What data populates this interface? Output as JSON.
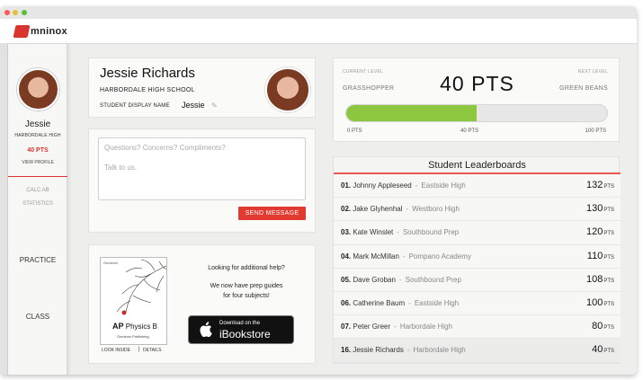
{
  "app": {
    "logo_text": "mninox",
    "brand_color": "#d9352e"
  },
  "sidebar": {
    "name": "Jessie",
    "school": "HARBORDALE HIGH",
    "points": "40 PTS",
    "view_profile": "VIEW PROFILE",
    "subject": "CALC AB",
    "statistics": "STATISTICS",
    "practice": "PRACTICE",
    "class": "CLASS"
  },
  "profile": {
    "name": "Jessie Richards",
    "school": "HARBORDALE HIGH SCHOOL",
    "display_name_label": "STUDENT DISPLAY NAME",
    "display_name": "Jessie"
  },
  "message": {
    "placeholder_line1": "Questions? Concerns? Compliments?",
    "placeholder_line2": "Talk to us.",
    "send_label": "SEND MESSAGE"
  },
  "promo": {
    "book_brand": "Omninox",
    "book_title_prefix": "AP",
    "book_title": "Physics B",
    "book_publisher": "Omninox Publishing",
    "look_inside": "LOOK INSIDE",
    "separator": "|",
    "details": "DETAILS",
    "question": "Looking for additional help?",
    "tagline_1": "We now have prep guides",
    "tagline_2": "for four subjects!",
    "store_line1": "Download on the",
    "store_line2": "iBookstore"
  },
  "level": {
    "current_label": "CURRENT LEVEL",
    "current": "GRASSHOPPER",
    "points": "40 PTS",
    "next_label": "NEXT LEVEL",
    "next": "GREEN BEANS",
    "progress_fraction": 0.5,
    "progress_color": "#8dc63f",
    "tick_start": "0 PTS",
    "tick_mid": "40 PTS",
    "tick_end": "100 PTS"
  },
  "leaderboard": {
    "title": "Student Leaderboards",
    "accent": "#e85a4f",
    "pts_unit": "PTS",
    "rows": [
      {
        "rank": "01.",
        "name": "Johnny Appleseed",
        "school": "Eastside High",
        "pts": "132"
      },
      {
        "rank": "02.",
        "name": "Jake Glyhenhal",
        "school": "Westboro High",
        "pts": "130"
      },
      {
        "rank": "03.",
        "name": "Kate Winslet",
        "school": "Southbound Prep",
        "pts": "120"
      },
      {
        "rank": "04.",
        "name": "Mark McMillan",
        "school": "Pompano Academy",
        "pts": "110"
      },
      {
        "rank": "05.",
        "name": "Dave Groban",
        "school": "Southbound Prep",
        "pts": "108"
      },
      {
        "rank": "06.",
        "name": "Catherine Baum",
        "school": "Eastside High",
        "pts": "100"
      },
      {
        "rank": "07.",
        "name": "Peter Greer",
        "school": "Harbordale High",
        "pts": "80"
      },
      {
        "rank": "16.",
        "name": "Jessie Richards",
        "school": "Harbordale High",
        "pts": "40"
      }
    ]
  }
}
